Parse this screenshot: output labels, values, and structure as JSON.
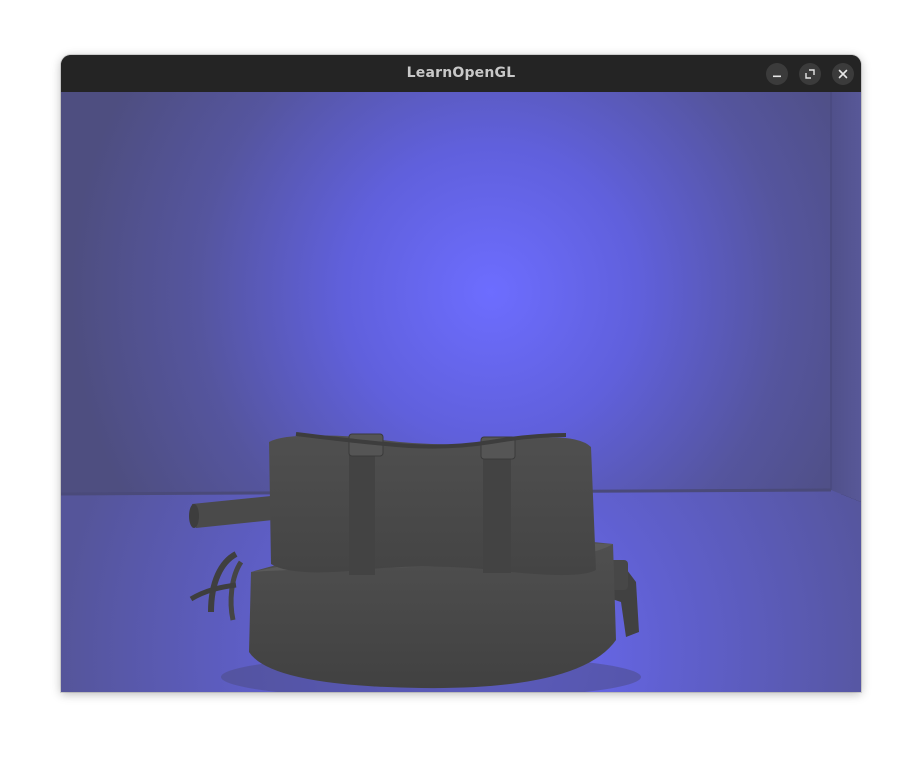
{
  "window": {
    "title": "LearnOpenGL",
    "controls": {
      "minimize_icon": "minimize-icon",
      "maximize_icon": "maximize-icon",
      "close_icon": "close-icon"
    }
  },
  "scene": {
    "light_color": "#6b6bff",
    "ambient_color": "#525288",
    "model_color": "#4a4a4a"
  }
}
